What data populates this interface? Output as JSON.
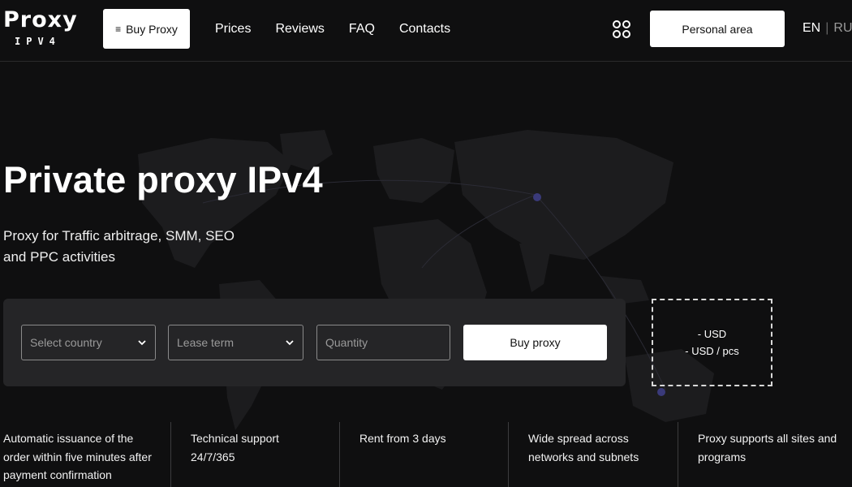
{
  "header": {
    "logo_word": "Proxy",
    "logo_sub": "IPV4",
    "buy_button": "Buy Proxy",
    "nav": [
      "Prices",
      "Reviews",
      "FAQ",
      "Contacts"
    ],
    "personal_area": "Personal area",
    "lang_current": "EN",
    "lang_other": "RU"
  },
  "hero": {
    "title": "Private proxy IPv4",
    "subtitle": "Proxy for Traffic arbitrage, SMM, SEO and PPC activities"
  },
  "order": {
    "country_placeholder": "Select country",
    "term_placeholder": "Lease term",
    "quantity_placeholder": "Quantity",
    "submit": "Buy proxy"
  },
  "price": {
    "total": "- USD",
    "per_piece": "- USD / pcs"
  },
  "features": [
    "Automatic issuance of the order within five minutes after payment confirmation",
    "Technical support 24/7/365",
    "Rent from 3 days",
    "Wide spread across networks and subnets",
    "Proxy supports all sites and programs"
  ]
}
